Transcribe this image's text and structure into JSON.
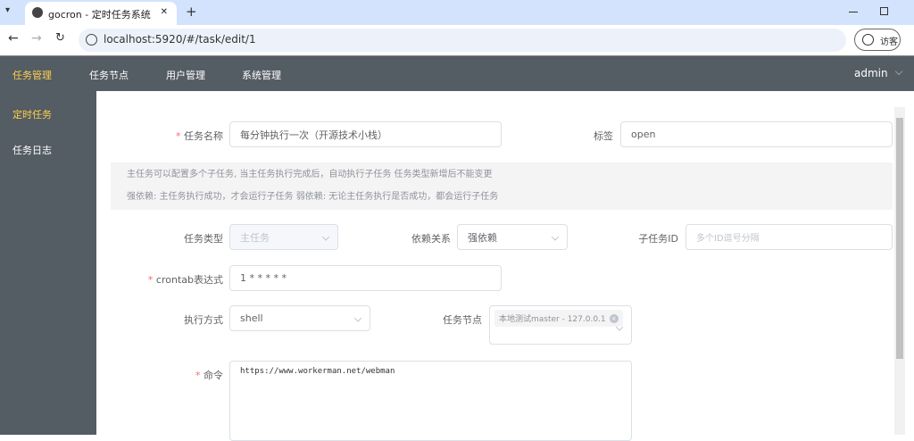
{
  "browser": {
    "tab_title": "gocron - 定时任务系统",
    "url": "localhost:5920/#/task/edit/1",
    "profile_label": "访客",
    "new_tab": "+",
    "close_tab": "✕"
  },
  "navbar": {
    "items": [
      "任务管理",
      "任务节点",
      "用户管理",
      "系统管理"
    ],
    "active_color": "#ffd04b",
    "user": "admin"
  },
  "sidebar": {
    "items": [
      "定时任务",
      "任务日志"
    ]
  },
  "form": {
    "name_label": "任务名称",
    "name_value": "每分钟执行一次（开源技术小栈）",
    "tag_label": "标签",
    "tag_value": "open",
    "info_line1": "主任务可以配置多个子任务, 当主任务执行完成后，自动执行子任务 任务类型新增后不能变更",
    "info_line2": "强依赖: 主任务执行成功，才会运行子任务 弱依赖: 无论主任务执行是否成功，都会运行子任务",
    "type_label": "任务类型",
    "type_value": "主任务",
    "dep_label": "依赖关系",
    "dep_value": "强依赖",
    "child_label": "子任务ID",
    "child_placeholder": "多个ID逗号分隔",
    "cron_label": "crontab表达式",
    "cron_value": "1 * * * * *",
    "exec_label": "执行方式",
    "exec_value": "shell",
    "node_label": "任务节点",
    "node_tag": "本地测试master - 127.0.0.1",
    "cmd_label": "命令",
    "cmd_value": "https://www.workerman.net/webman"
  }
}
